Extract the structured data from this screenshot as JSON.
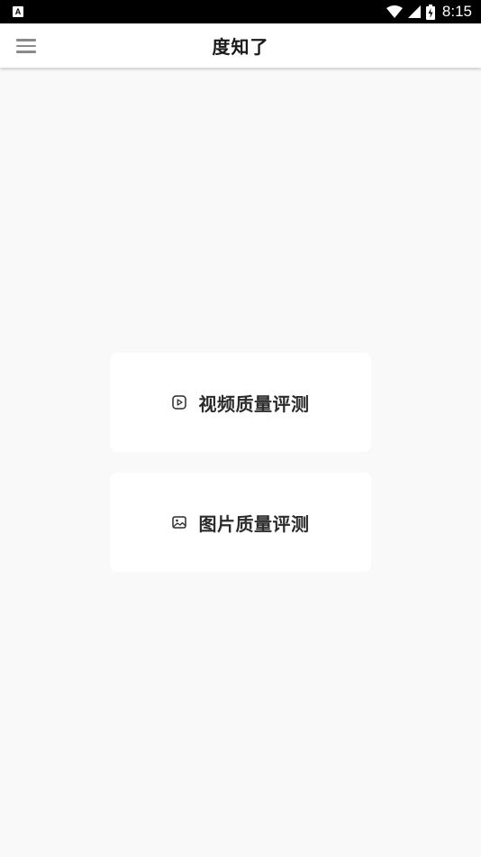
{
  "status_bar": {
    "notification_icon_letter": "A",
    "time": "8:15"
  },
  "header": {
    "title": "度知了",
    "menu_icon": "hamburger-menu-icon"
  },
  "main": {
    "cards": [
      {
        "label": "视频质量评测",
        "icon": "video-play-icon"
      },
      {
        "label": "图片质量评测",
        "icon": "image-icon"
      }
    ]
  },
  "colors": {
    "background": "#f9f9f9",
    "card": "#ffffff",
    "text": "#2b2b2b",
    "menu_icon": "#8a8a8a"
  }
}
